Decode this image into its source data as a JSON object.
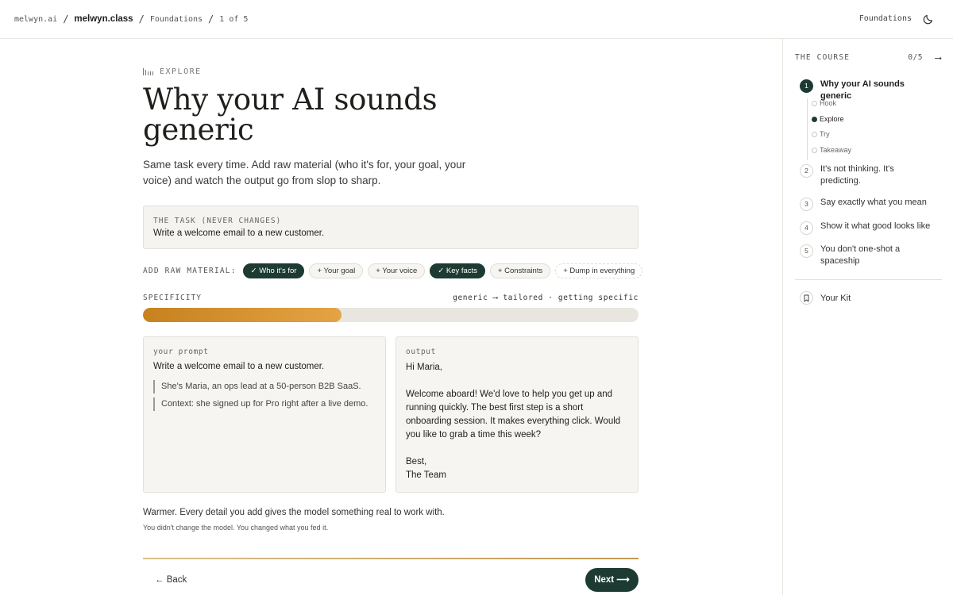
{
  "header": {
    "breadcrumb": [
      "melwyn.ai",
      "melwyn.class",
      "Foundations",
      "1 of 5"
    ],
    "separator": "/",
    "section_label": "Foundations",
    "theme_icon": "moon-icon"
  },
  "lesson": {
    "eyebrow": "EXPLORE",
    "title": "Why your AI sounds generic",
    "lede": "Same task every time. Add raw material (who it's for, your goal, your voice) and watch the output go from slop to sharp.",
    "task_caption": "THE TASK (NEVER CHANGES)",
    "task": "Write a welcome email to a new customer.",
    "chips_caption": "ADD RAW MATERIAL:",
    "chips": [
      {
        "label": "✓ Who it's for",
        "selected": true
      },
      {
        "label": "+ Your goal",
        "selected": false
      },
      {
        "label": "+ Your voice",
        "selected": false
      },
      {
        "label": "✓ Key facts",
        "selected": true
      },
      {
        "label": "+ Constraints",
        "selected": false
      },
      {
        "label": "+ Dump in everything",
        "selected": false
      }
    ],
    "specificity_caption": "SPECIFICITY",
    "specificity_scale": "generic ⟶ tailored · getting specific",
    "specificity_level": 0.4,
    "prompt_caption": "your prompt",
    "prompt_base": "Write a welcome email to a new customer.",
    "prompt_additions": [
      "She's Maria, an ops lead at a 50-person B2B SaaS.",
      "Context: she signed up for Pro right after a live demo."
    ],
    "output_caption": "output",
    "output_greeting": "Hi Maria,",
    "output_body": "Welcome aboard! We'd love to help you get up and running quickly. The best first step is a short onboarding session. It makes everything click. Would you like to grab a time this week?",
    "output_signoff_1": "Best,",
    "output_signoff_2": "The Team",
    "verdict": "Warmer. Every detail you add gives the model something real to work with.",
    "verdict_sub": "You didn't change the model. You changed what you fed it.",
    "back_label": "← Back",
    "next_label": "Next ⟶",
    "accent_color": "#1e3b33",
    "meter_color": "#d89433"
  },
  "sidebar": {
    "heading": "THE COURSE",
    "progress": "0/5",
    "arrow": "⟶",
    "lessons": [
      {
        "num": "1",
        "title": "Why your AI sounds generic",
        "active": true
      },
      {
        "num": "2",
        "title": "It's not thinking. It's predicting.",
        "active": false
      },
      {
        "num": "3",
        "title": "Say exactly what you mean",
        "active": false
      },
      {
        "num": "4",
        "title": "Show it what good looks like",
        "active": false
      },
      {
        "num": "5",
        "title": "You don't one-shot a spaceship",
        "active": false
      }
    ],
    "steps": [
      {
        "label": "Hook",
        "active": false
      },
      {
        "label": "Explore",
        "active": true
      },
      {
        "label": "Try",
        "active": false
      },
      {
        "label": "Takeaway",
        "active": false
      }
    ],
    "kit_label": "Your Kit",
    "kit_icon": "bookmark-icon"
  }
}
